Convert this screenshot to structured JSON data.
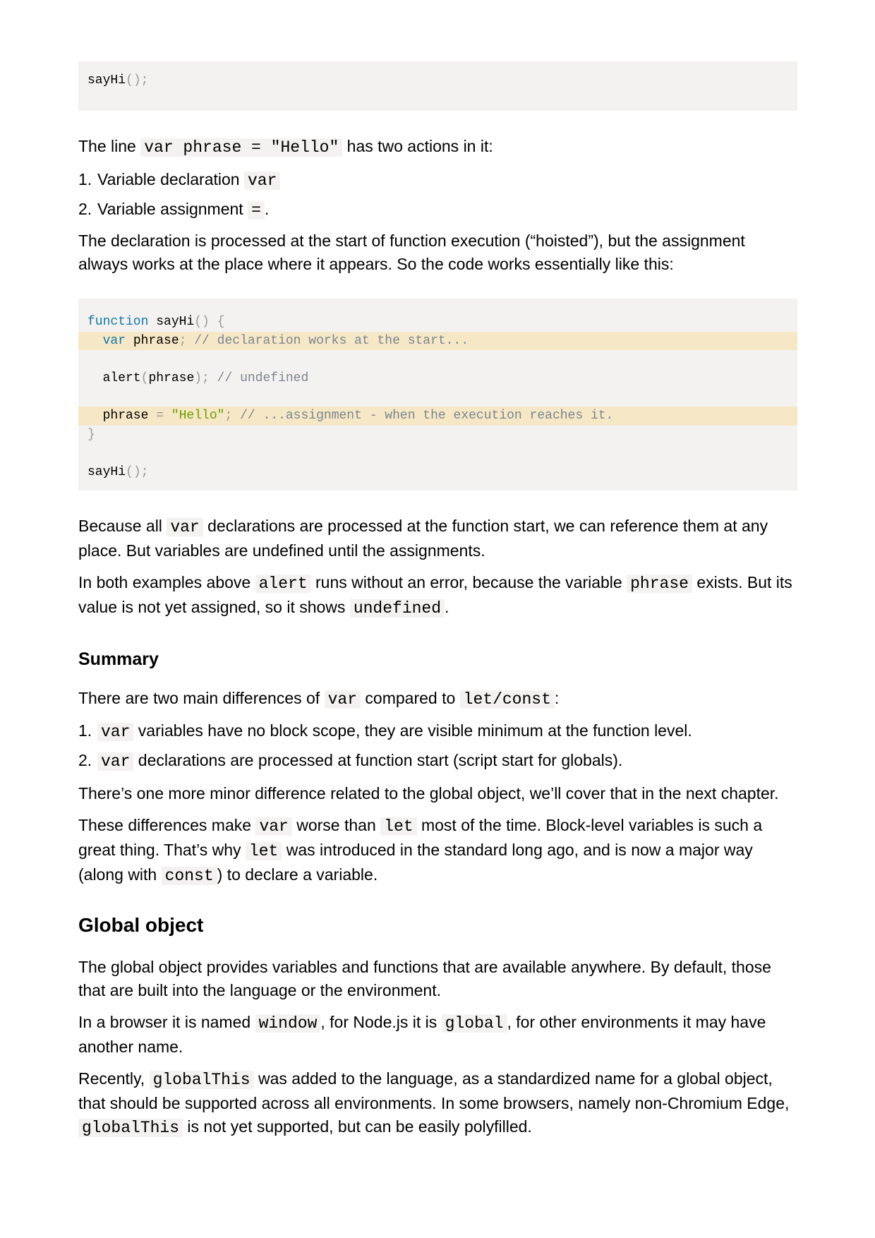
{
  "code1": {
    "call": "sayHi",
    "call_paren": "();"
  },
  "p1": {
    "before": "The line ",
    "code": "var phrase = \"Hello\"",
    "after": " has two actions in it:"
  },
  "list1": [
    {
      "num": "1.",
      "text": "Variable declaration ",
      "code": "var",
      "after": ""
    },
    {
      "num": "2.",
      "text": "Variable assignment ",
      "code": "=",
      "after": "."
    }
  ],
  "p2": "The declaration is processed at the start of function execution (“hoisted”), but the assignment always works at the place where it appears. So the code works essentially like this:",
  "code2": {
    "l1_kw": "function",
    "l1_name": " sayHi",
    "l1_pn": "() {",
    "l2_kw": "  var",
    "l2_id": " phrase",
    "l2_pn": ";",
    "l2_cm": " // declaration works at the start...",
    "l4_fn": "  alert",
    "l4_pn1": "(",
    "l4_id": "phrase",
    "l4_pn2": ");",
    "l4_cm": " // undefined",
    "l6_id": "  phrase",
    "l6_op": " =",
    "l6_str": " \"Hello\"",
    "l6_pn": ";",
    "l6_cm": " // ...assignment - when the execution reaches it.",
    "l7_pn": "}",
    "l9_fn": "sayHi",
    "l9_pn": "();"
  },
  "p3": {
    "before": "Because all ",
    "code": "var",
    "after": " declarations are processed at the function start, we can reference them at any place. But variables are undefined until the assignments."
  },
  "p4": {
    "t1": "In both examples above ",
    "c1": "alert",
    "t2": " runs without an error, because the variable ",
    "c2": "phrase",
    "t3": " exists. But its value is not yet assigned, so it shows ",
    "c3": "undefined",
    "t4": "."
  },
  "summary": {
    "heading": "Summary",
    "intro": {
      "t1": "There are two main differences of ",
      "c1": "var",
      "t2": " compared to ",
      "c2": "let/const",
      "t3": ":"
    },
    "items": [
      {
        "num": "1.",
        "code": "var",
        "text": " variables have no block scope, they are visible minimum at the function level."
      },
      {
        "num": "2.",
        "code": "var",
        "text": " declarations are processed at function start (script start for globals)."
      }
    ],
    "p_minor": "There’s one more minor difference related to the global object, we’ll cover that in the next chapter.",
    "p_diff": {
      "t1": "These differences make ",
      "c1": "var",
      "t2": " worse than ",
      "c2": "let",
      "t3": " most of the time. Block-level variables is such a great thing. That’s why ",
      "c3": "let",
      "t4": " was introduced in the standard long ago, and is now a major way (along with ",
      "c4": "const",
      "t5": ") to declare a variable."
    }
  },
  "global": {
    "heading": "Global object",
    "p1": "The global object provides variables and functions that are available anywhere. By default, those that are built into the language or the environment.",
    "p2": {
      "t1": "In a browser it is named ",
      "c1": "window",
      "t2": ", for Node.js it is ",
      "c2": "global",
      "t3": ", for other environments it may have another name."
    },
    "p3": {
      "t1": "Recently, ",
      "c1": "globalThis",
      "t2": " was added to the language, as a standardized name for a global object, that should be supported across all environments. In some browsers, namely non-Chromium Edge, ",
      "c2": "globalThis",
      "t3": " is not yet supported, but can be easily polyfilled."
    }
  }
}
